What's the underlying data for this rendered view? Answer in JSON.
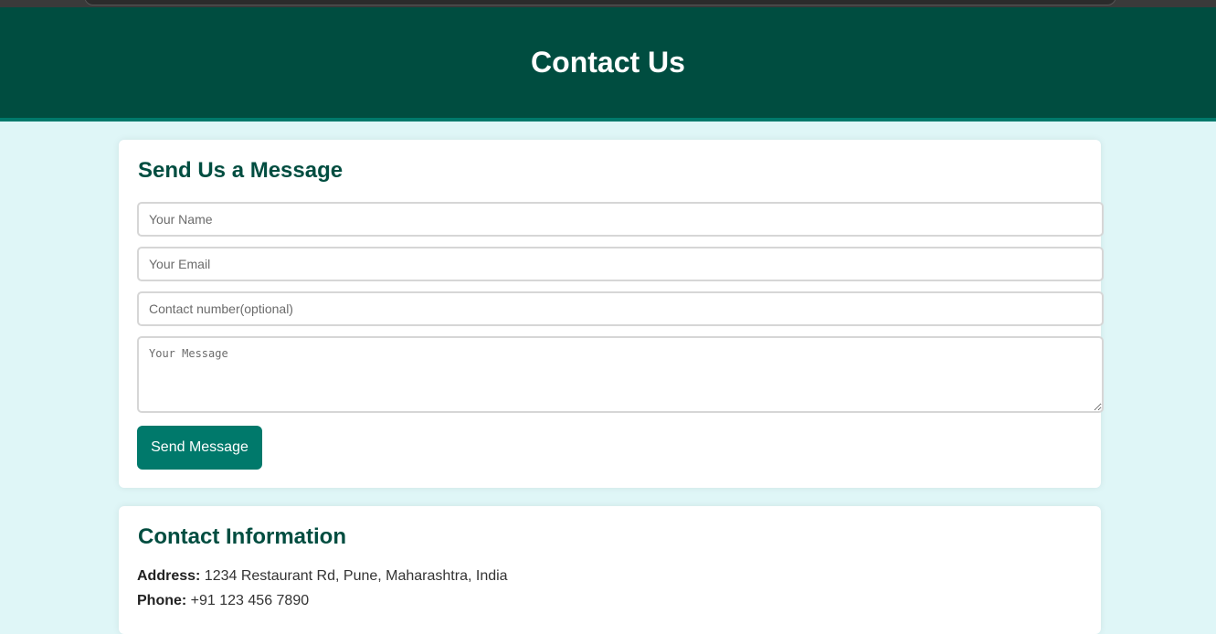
{
  "header": {
    "title": "Contact Us"
  },
  "form": {
    "title": "Send Us a Message",
    "name_placeholder": "Your Name",
    "email_placeholder": "Your Email",
    "phone_placeholder": "Contact number(optional)",
    "message_placeholder": "Your Message",
    "submit_label": "Send Message"
  },
  "info": {
    "title": "Contact Information",
    "address_label": "Address:",
    "address_value": " 1234 Restaurant Rd, Pune, Maharashtra, India",
    "phone_label": "Phone:",
    "phone_value": " +91 123 456 7890"
  },
  "colors": {
    "header_bg": "#004d40",
    "header_border": "#00796b",
    "page_bg": "#dff6f7",
    "button_bg": "#00796b",
    "heading_text": "#004d40"
  }
}
